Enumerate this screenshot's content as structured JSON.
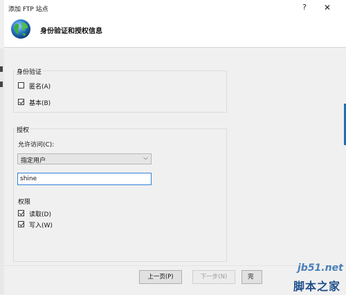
{
  "window": {
    "title": "添加 FTP 站点",
    "help_glyph": "?",
    "close_glyph": "✕"
  },
  "header": {
    "title": "身份验证和授权信息",
    "icon": "globe-icon"
  },
  "authentication": {
    "group_label": "身份验证",
    "anonymous": {
      "label": "匿名(A)",
      "checked": false
    },
    "basic": {
      "label": "基本(B)",
      "checked": true
    }
  },
  "authorization": {
    "group_label": "授权",
    "allow_access_label": "允许访问(C):",
    "allow_access_selected": "指定用户",
    "user_value": "shine",
    "permissions_label": "权限",
    "read": {
      "label": "读取(D)",
      "checked": true
    },
    "write": {
      "label": "写入(W)",
      "checked": true
    }
  },
  "footer": {
    "prev_label": "上一页(P)",
    "next_label": "下一步(N)",
    "next_enabled": false,
    "finish_label": "完"
  },
  "watermark": {
    "logo": "jb51.net",
    "text": "脚本之家"
  }
}
